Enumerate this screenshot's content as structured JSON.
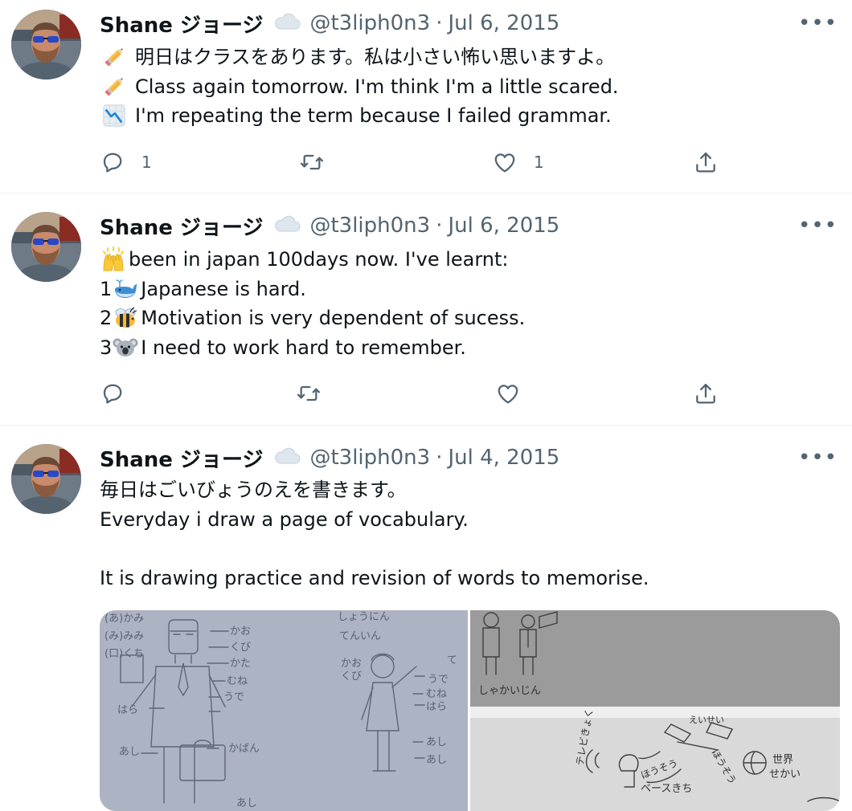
{
  "tweets": [
    {
      "author": "Shane ジョージ",
      "handle": "@t3liph0n3",
      "separator": "·",
      "date": "Jul 6, 2015",
      "more": "•••",
      "lines": [
        "明日はクラスをあります。私は小さい怖い思いますよ。",
        "Class again tomorrow. I'm think I'm  a little scared.",
        "I'm repeating the term because I failed grammar."
      ],
      "line_emoji": [
        "pencil-icon",
        "pencil-icon",
        "chart-decreasing-icon"
      ],
      "replies": "1",
      "likes": "1"
    },
    {
      "author": "Shane ジョージ",
      "handle": "@t3liph0n3",
      "separator": "·",
      "date": "Jul 6, 2015",
      "more": "•••",
      "lines": [
        "been in japan 100days now. I've learnt:",
        "Japanese is hard.",
        "Motivation is very dependent of sucess.",
        "I need to work hard to remember."
      ],
      "line_prefix": [
        "",
        "1",
        "2",
        "3"
      ],
      "line_emoji": [
        "raised-hands-icon",
        "whale-icon",
        "bee-icon",
        "koala-icon"
      ]
    },
    {
      "author": "Shane ジョージ",
      "handle": "@t3liph0n3",
      "separator": "·",
      "date": "Jul 4, 2015",
      "more": "•••",
      "lines": [
        "毎日はごいびょうのえを書きます。",
        "Everyday i draw a page of vocabulary.",
        "",
        "It is drawing practice and revision of words to memorise."
      ],
      "media": {
        "left_sketch": {
          "labels": [
            "(あ)かみ",
            "(み)みみ",
            "(口)くち",
            "かお",
            "くび",
            "かた",
            "むね",
            "うで",
            "はら",
            "あし",
            "かばん",
            "あし",
            "しょうにん",
            "てんいん",
            "かお",
            "くび",
            "て",
            "うで",
            "むね",
            "はら",
            "あし",
            "あし"
          ]
        },
        "right_sketch": {
          "labels": [
            "しゃかいじん",
            "えいせい",
            "テレビきょく",
            "ほうそう",
            "ベースきち",
            "ほうそう",
            "世界",
            "せかい"
          ]
        }
      }
    }
  ],
  "colors": {
    "text": "#0f1419",
    "secondary": "#536471",
    "divider": "#eff3f4"
  }
}
